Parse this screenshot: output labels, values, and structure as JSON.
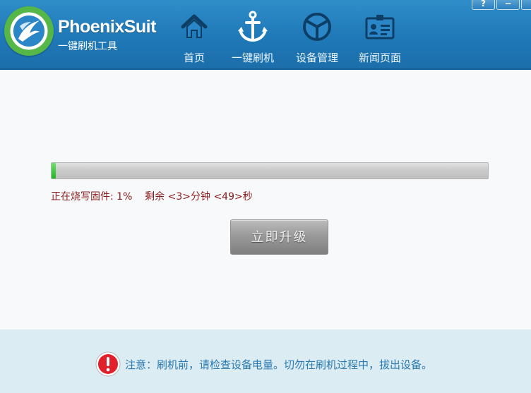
{
  "app": {
    "brand": "PhoenixSuit",
    "subtitle": "一键刷机工具"
  },
  "nav": {
    "items": [
      {
        "label": "首页",
        "icon": "home-icon"
      },
      {
        "label": "一键刷机",
        "icon": "anchor-icon"
      },
      {
        "label": "设备管理",
        "icon": "cube-icon"
      },
      {
        "label": "新闻页面",
        "icon": "id-card-icon"
      }
    ]
  },
  "window": {
    "help": "?",
    "minimize": "−"
  },
  "flash": {
    "progress_percent": 1,
    "status_text": "正在烧写固件: 1%    剩余 <3>分钟 <49>秒",
    "upgrade_label": "立即升级"
  },
  "footer": {
    "notice": "注意：刷机前，请检查设备电量。切勿在刷机过程中，拔出设备。"
  },
  "colors": {
    "header": "#1f78b7",
    "progress_fill": "#1fb51f",
    "status_text": "#8b1a1a",
    "footer_bg": "#dcecf3",
    "notice_text": "#2a7ab0",
    "warning": "#e0202a"
  }
}
